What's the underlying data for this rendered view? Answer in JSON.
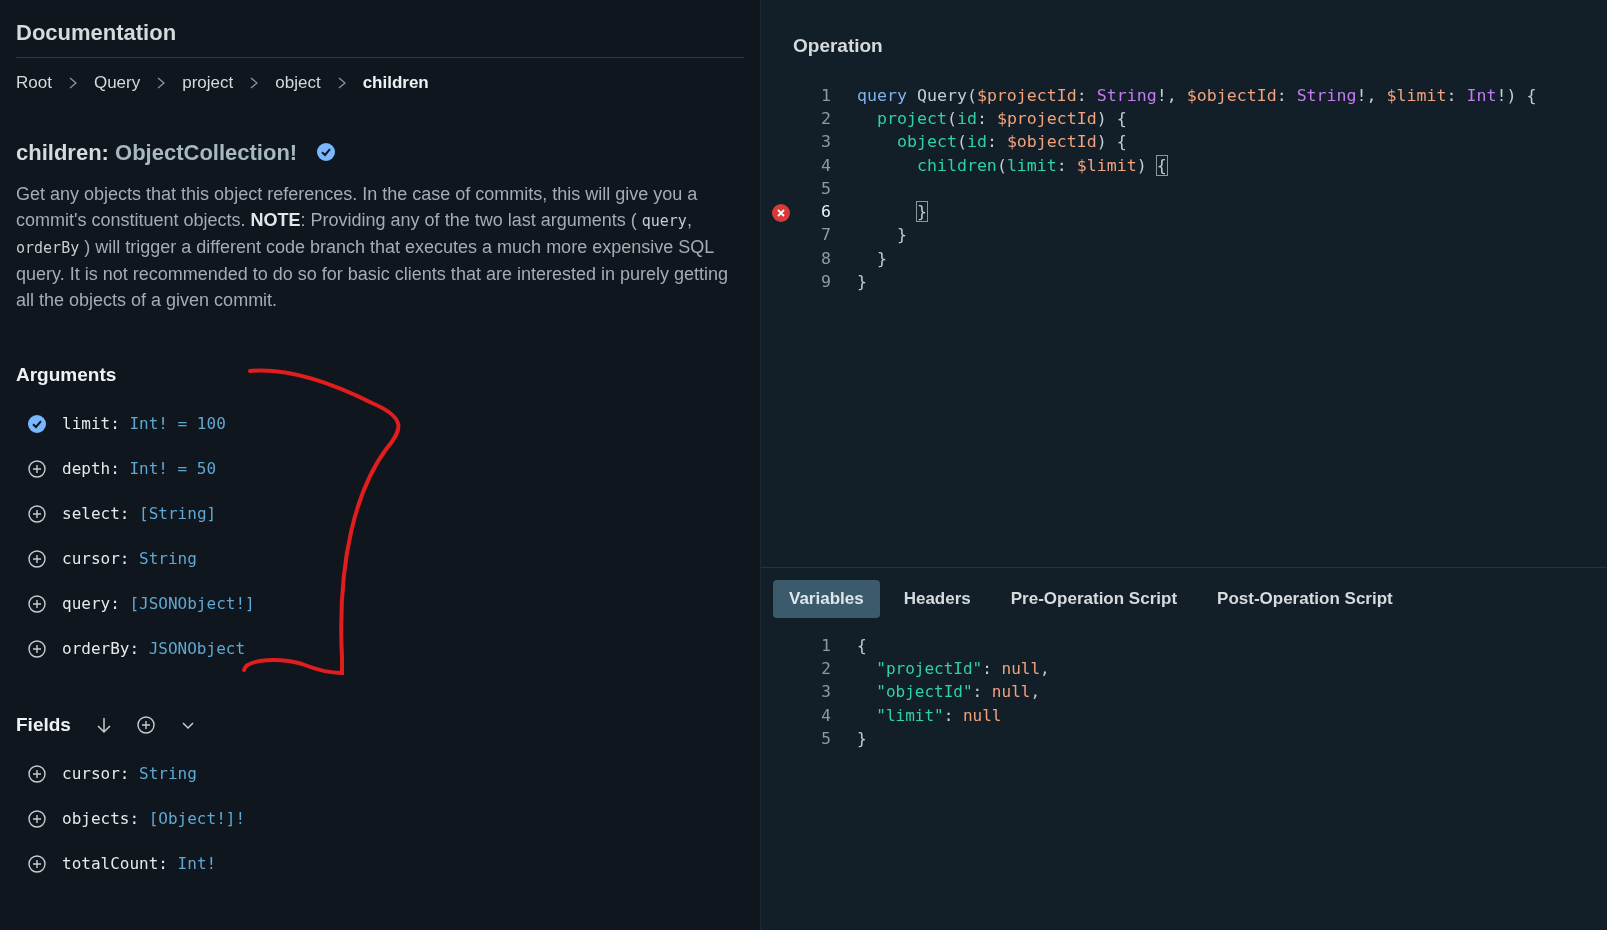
{
  "docs": {
    "title": "Documentation",
    "breadcrumbs": [
      {
        "label": "Root",
        "selected": false
      },
      {
        "label": "Query",
        "selected": false
      },
      {
        "label": "project",
        "selected": false
      },
      {
        "label": "object",
        "selected": false
      },
      {
        "label": "children",
        "selected": true
      }
    ],
    "field": {
      "name": "children:",
      "type": "ObjectCollection!",
      "selected": true
    },
    "description": [
      {
        "kind": "text",
        "text": "Get any objects that this object references. In the case of commits, this will give you a commit's constituent objects. **NOTE**: Providing any of the two last arguments ( "
      },
      {
        "kind": "code",
        "text": "query"
      },
      {
        "kind": "text",
        "text": ", "
      },
      {
        "kind": "code",
        "text": "orderBy"
      },
      {
        "kind": "text",
        "text": " ) will trigger a different code branch that executes a much more expensive SQL query. It is not recommended to do so for basic clients that are interested in purely getting all the objects of a given commit."
      }
    ],
    "arguments": {
      "title": "Arguments",
      "items": [
        {
          "name": "limit:",
          "type": "Int! = 100",
          "checked": true
        },
        {
          "name": "depth:",
          "type": "Int! = 50",
          "checked": false
        },
        {
          "name": "select:",
          "type": "[String]",
          "checked": false
        },
        {
          "name": "cursor:",
          "type": "String",
          "checked": false
        },
        {
          "name": "query:",
          "type": "[JSONObject!]",
          "checked": false
        },
        {
          "name": "orderBy:",
          "type": "JSONObject",
          "checked": false
        }
      ]
    },
    "fields": {
      "title": "Fields",
      "items": [
        {
          "name": "cursor:",
          "type": "String",
          "checked": false
        },
        {
          "name": "objects:",
          "type": "[Object!]!",
          "checked": false
        },
        {
          "name": "totalCount:",
          "type": "Int!",
          "checked": false
        }
      ]
    }
  },
  "operation": {
    "title": "Operation",
    "lines": [
      {
        "number": "1",
        "error": false,
        "active": false,
        "tokens": [
          {
            "kind": "keyword",
            "text": "query"
          },
          {
            "kind": "plain",
            "text": " Query("
          },
          {
            "kind": "var",
            "text": "$projectId"
          },
          {
            "kind": "plain",
            "text": ": "
          },
          {
            "kind": "type",
            "text": "String"
          },
          {
            "kind": "plain",
            "text": "!, "
          },
          {
            "kind": "var",
            "text": "$objectId"
          },
          {
            "kind": "plain",
            "text": ": "
          },
          {
            "kind": "type",
            "text": "String"
          },
          {
            "kind": "plain",
            "text": "!, "
          },
          {
            "kind": "var",
            "text": "$limit"
          },
          {
            "kind": "plain",
            "text": ": "
          },
          {
            "kind": "type",
            "text": "Int"
          },
          {
            "kind": "plain",
            "text": "!) {"
          }
        ]
      },
      {
        "number": "2",
        "error": false,
        "active": false,
        "tokens": [
          {
            "kind": "field",
            "text": "  project"
          },
          {
            "kind": "plain",
            "text": "("
          },
          {
            "kind": "field",
            "text": "id"
          },
          {
            "kind": "plain",
            "text": ": "
          },
          {
            "kind": "var",
            "text": "$projectId"
          },
          {
            "kind": "plain",
            "text": ") {"
          }
        ]
      },
      {
        "number": "3",
        "error": false,
        "active": false,
        "tokens": [
          {
            "kind": "field",
            "text": "    object"
          },
          {
            "kind": "plain",
            "text": "("
          },
          {
            "kind": "field",
            "text": "id"
          },
          {
            "kind": "plain",
            "text": ": "
          },
          {
            "kind": "var",
            "text": "$objectId"
          },
          {
            "kind": "plain",
            "text": ") {"
          }
        ]
      },
      {
        "number": "4",
        "error": false,
        "active": false,
        "tokens": [
          {
            "kind": "field",
            "text": "      children"
          },
          {
            "kind": "plain",
            "text": "("
          },
          {
            "kind": "field",
            "text": "limit"
          },
          {
            "kind": "plain",
            "text": ": "
          },
          {
            "kind": "var",
            "text": "$limit"
          },
          {
            "kind": "plain",
            "text": ") "
          },
          {
            "kind": "match",
            "text": "{"
          }
        ]
      },
      {
        "number": "5",
        "error": false,
        "active": false
      },
      {
        "number": "6",
        "error": true,
        "active": true,
        "tokens": [
          {
            "kind": "match",
            "text": "      }"
          }
        ]
      },
      {
        "number": "7",
        "error": false,
        "active": false,
        "tokens": [
          {
            "kind": "plain",
            "text": "    }"
          }
        ]
      },
      {
        "number": "8",
        "error": false,
        "active": false,
        "tokens": [
          {
            "kind": "plain",
            "text": "  }"
          }
        ]
      },
      {
        "number": "9",
        "error": false,
        "active": false,
        "tokens": [
          {
            "kind": "plain",
            "text": "}"
          }
        ]
      }
    ]
  },
  "tabs": [
    {
      "label": "Variables",
      "selected": true
    },
    {
      "label": "Headers",
      "selected": false
    },
    {
      "label": "Pre-Operation Script",
      "selected": false
    },
    {
      "label": "Post-Operation Script",
      "selected": false
    }
  ],
  "variables": {
    "lines": [
      {
        "number": "1",
        "error": false,
        "active": false,
        "tokens": [
          {
            "kind": "plain",
            "text": "{"
          }
        ]
      },
      {
        "number": "2",
        "error": false,
        "active": false,
        "tokens": [
          {
            "kind": "field",
            "text": "  \"projectId\""
          },
          {
            "kind": "plain",
            "text": ": "
          },
          {
            "kind": "var",
            "text": "null"
          },
          {
            "kind": "plain",
            "text": ","
          }
        ]
      },
      {
        "number": "3",
        "error": false,
        "active": false,
        "tokens": [
          {
            "kind": "field",
            "text": "  \"objectId\""
          },
          {
            "kind": "plain",
            "text": ": "
          },
          {
            "kind": "var",
            "text": "null"
          },
          {
            "kind": "plain",
            "text": ","
          }
        ]
      },
      {
        "number": "4",
        "error": false,
        "active": false,
        "tokens": [
          {
            "kind": "field",
            "text": "  \"limit\""
          },
          {
            "kind": "plain",
            "text": ": "
          },
          {
            "kind": "var",
            "text": "null"
          }
        ]
      },
      {
        "number": "5",
        "error": false,
        "active": false,
        "tokens": [
          {
            "kind": "plain",
            "text": "}"
          }
        ]
      }
    ]
  }
}
